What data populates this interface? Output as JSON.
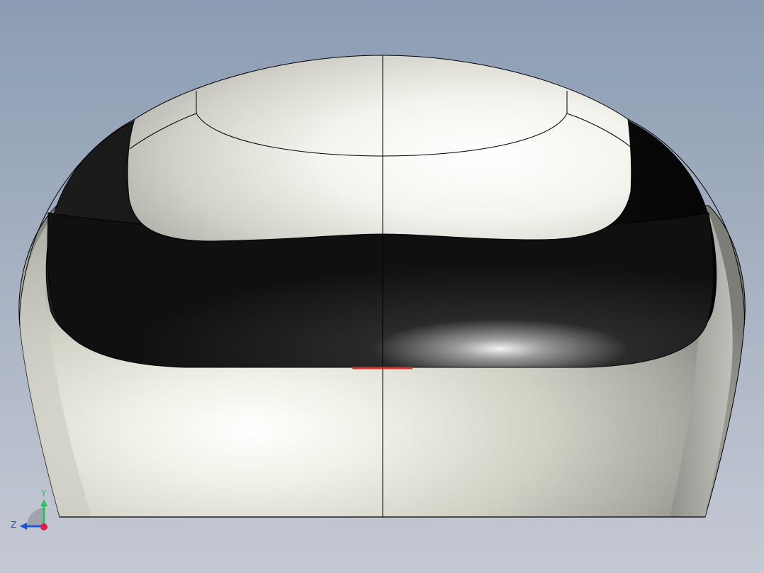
{
  "viewport": {
    "background_top": "#8c9db3",
    "background_bottom": "#c4c8d3"
  },
  "model": {
    "shell_color": "#e9e9e0",
    "visor_color": "#141414",
    "edge_color": "#000000",
    "highlight_color": "#ff3b30"
  },
  "triad": {
    "y_label": "Y",
    "z_label": "Z",
    "y_color": "#22c55e",
    "z_color": "#1d4ed8",
    "origin_color": "#e11d48"
  }
}
